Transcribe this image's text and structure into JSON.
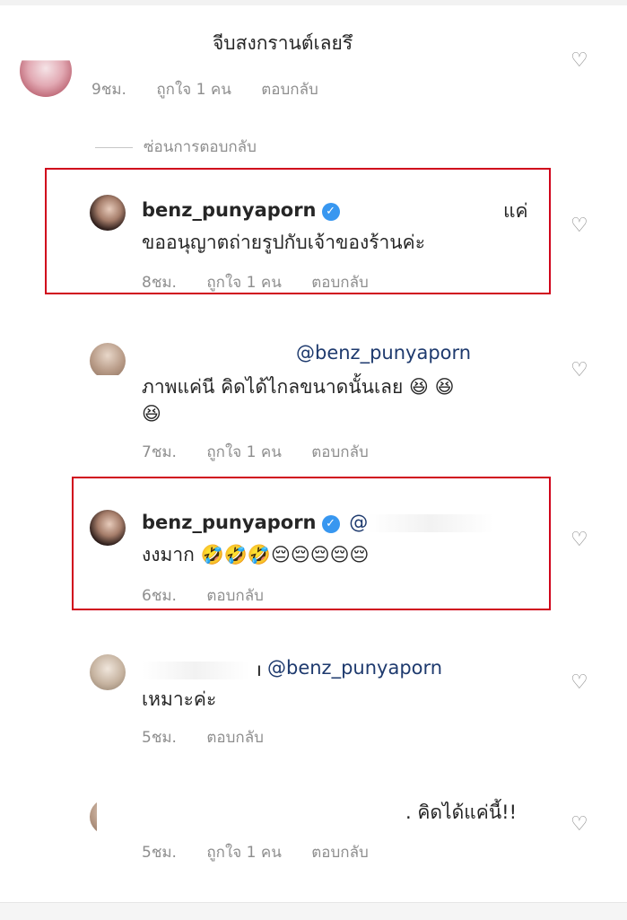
{
  "comments": [
    {
      "text": "จีบสงกรานต์เลยรึ",
      "time": "9ชม.",
      "likes": "ถูกใจ 1 คน",
      "reply": "ตอบกลับ"
    },
    {
      "hide_replies": "ซ่อนการตอบกลับ"
    },
    {
      "username": "benz_punyaporn",
      "verified": "✓",
      "line1_tail": "แค่",
      "line2": "ขออนุญาตถ่ายรูปกับเจ้าของร้านค่ะ",
      "time": "8ชม.",
      "likes": "ถูกใจ 1 คน",
      "reply": "ตอบกลับ"
    },
    {
      "mention": "@benz_punyaporn",
      "line2": "ภาพแค่นี คิดได้ไกลขนาดนั้นเลย 😆 😆",
      "line3": "😆",
      "time": "7ชม.",
      "likes": "ถูกใจ 1 คน",
      "reply": "ตอบกลับ"
    },
    {
      "username": "benz_punyaporn",
      "verified": "✓",
      "mention_partial": "@",
      "line2": "งงมาก 🤣🤣🤣😔😔😔😔😔",
      "time": "6ชม.",
      "reply": "ตอบกลับ"
    },
    {
      "name_fragment": "ı",
      "mention": "@benz_punyaporn",
      "line2": "เหมาะค่ะ",
      "time": "5ชม.",
      "reply": "ตอบกลับ"
    },
    {
      "text": ". คิดได้แค่นี้!!",
      "time": "5ชม.",
      "likes": "ถูกใจ 1 คน",
      "reply": "ตอบกลับ"
    }
  ],
  "icons": {
    "heart": "heart-outline-icon",
    "verified": "verified-badge-icon"
  },
  "colors": {
    "highlight_box": "#d0021b",
    "verified": "#3897f0",
    "meta": "#8e8e8e"
  }
}
